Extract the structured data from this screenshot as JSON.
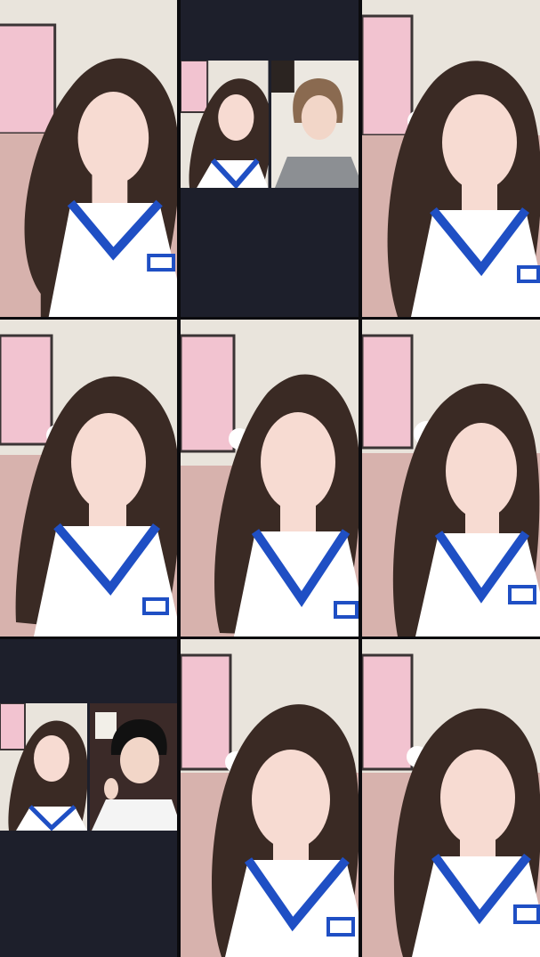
{
  "grid": {
    "columns": 3,
    "rows": 3,
    "tiles": [
      {
        "id": "r1c1",
        "kind": "single"
      },
      {
        "id": "r1c2",
        "kind": "co-stream"
      },
      {
        "id": "r1c3",
        "kind": "single"
      },
      {
        "id": "r2c1",
        "kind": "single"
      },
      {
        "id": "r2c2",
        "kind": "single"
      },
      {
        "id": "r2c3",
        "kind": "single"
      },
      {
        "id": "r3c1",
        "kind": "co-stream"
      },
      {
        "id": "r3c2",
        "kind": "single"
      },
      {
        "id": "r3c3",
        "kind": "single"
      }
    ]
  },
  "colors": {
    "background": "#0b0b0e",
    "split_panel": "#1d1f2b",
    "wall": "#e9e4dc",
    "sofa": "#d7b2ad",
    "jersey": "#ffffff",
    "jersey_trim": "#1f4fc4",
    "hair": "#3a2a24",
    "poster_pink": "#f2c3d0"
  },
  "icons": [
    "poster-image",
    "plush-toy",
    "jersey-logo"
  ]
}
